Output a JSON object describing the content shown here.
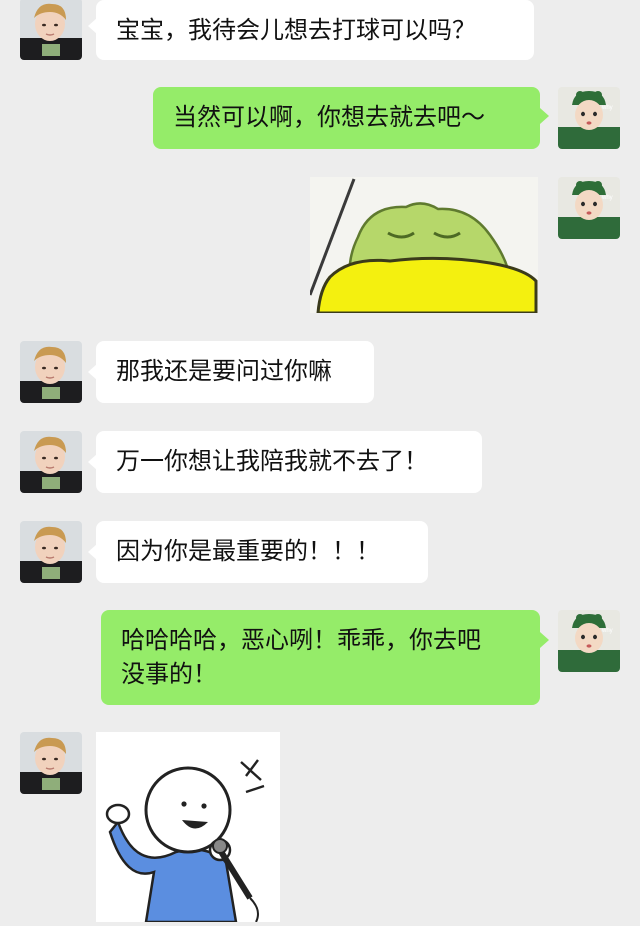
{
  "messages": [
    {
      "side": "left",
      "type": "text",
      "text": "宝宝，我待会儿想去打球可以吗？"
    },
    {
      "side": "right",
      "type": "text",
      "text": "当然可以啊，你想去就去吧～"
    },
    {
      "side": "right",
      "type": "sticker",
      "sticker": "sleeping-frog-sticker"
    },
    {
      "side": "left",
      "type": "text",
      "text": "那我还是要问过你嘛"
    },
    {
      "side": "left",
      "type": "text",
      "text": "万一你想让我陪我就不去了！"
    },
    {
      "side": "left",
      "type": "text",
      "text": "因为你是最重要的！！！"
    },
    {
      "side": "right",
      "type": "text",
      "text": "哈哈哈哈，恶心咧！乖乖，你去吧\n没事的！"
    },
    {
      "side": "left",
      "type": "sticker",
      "sticker": "singing-stickman-sticker"
    }
  ],
  "colors": {
    "background": "#ededed",
    "left_bubble": "#ffffff",
    "right_bubble": "#95ec69"
  }
}
